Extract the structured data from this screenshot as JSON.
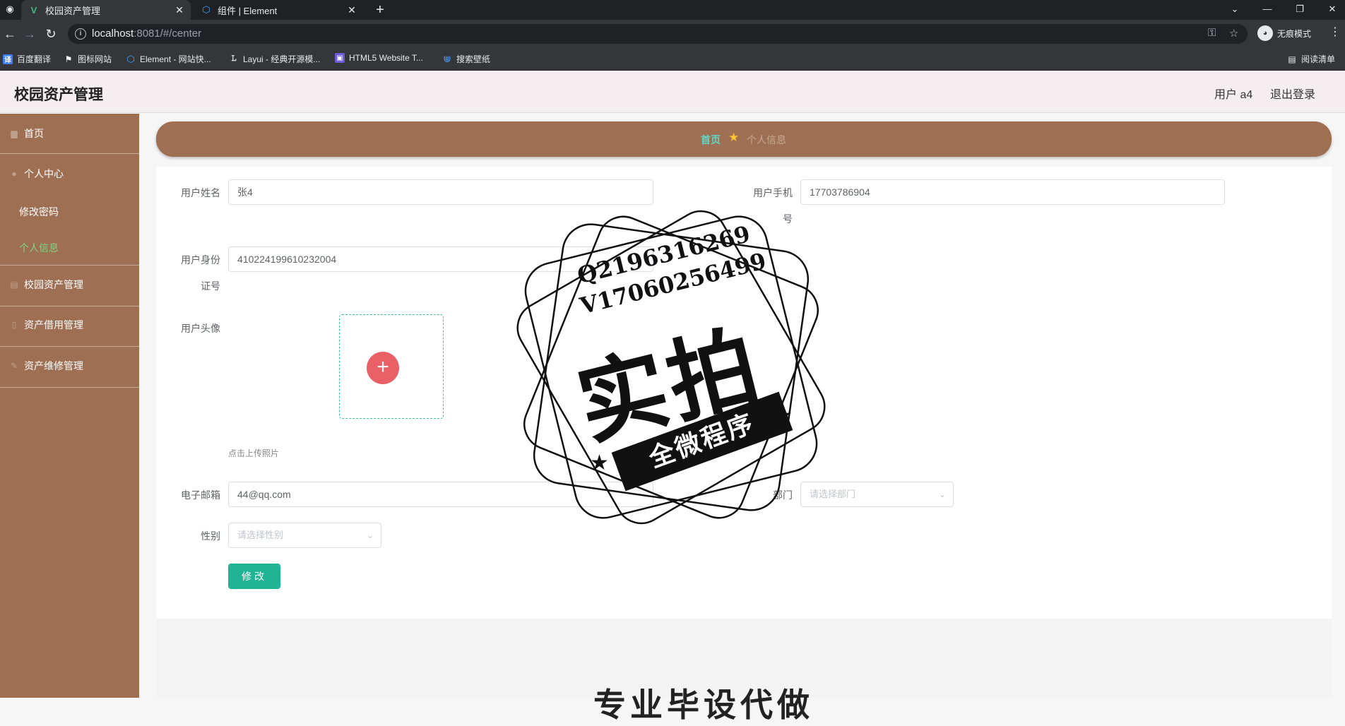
{
  "browser": {
    "tabs": [
      {
        "title": "校园资产管理",
        "active": true,
        "icon": "vue-icon"
      },
      {
        "title": "组件 | Element",
        "active": false,
        "icon": "element-icon"
      }
    ],
    "url_host": "localhost",
    "url_rest": ":8081/#/center",
    "incognito_label": "无痕模式",
    "bookmarks": [
      {
        "label": "百度翻译",
        "icon": "translate-icon",
        "color": "#3f7ef6"
      },
      {
        "label": "图标网站",
        "icon": "flag-icon",
        "color": "#ffffff"
      },
      {
        "label": "Element - 网站快...",
        "icon": "element-icon",
        "color": "#409eff"
      },
      {
        "label": "Layui - 经典开源模...",
        "icon": "layui-icon",
        "color": "#ffffff"
      },
      {
        "label": "HTML5 Website T...",
        "icon": "html5-icon",
        "color": "#6b5bd6"
      },
      {
        "label": "搜索壁纸",
        "icon": "wallpaper-icon",
        "color": "#4a90e2"
      }
    ],
    "reading_list_label": "阅读清单"
  },
  "header": {
    "title": "校园资产管理",
    "user_label": "用户 a4",
    "logout_label": "退出登录"
  },
  "sidebar": {
    "items": [
      {
        "label": "首页",
        "icon": "home-icon"
      },
      {
        "label": "个人中心",
        "icon": "user-icon",
        "children": [
          {
            "label": "修改密码",
            "active": false
          },
          {
            "label": "个人信息",
            "active": true
          }
        ]
      },
      {
        "label": "校园资产管理",
        "icon": "asset-icon"
      },
      {
        "label": "资产借用管理",
        "icon": "borrow-icon"
      },
      {
        "label": "资产维修管理",
        "icon": "repair-icon"
      }
    ]
  },
  "breadcrumb": {
    "home": "首页",
    "current": "个人信息"
  },
  "form": {
    "name_label": "用户姓名",
    "name_value": "张4",
    "phone_label_1": "用户手机",
    "phone_label_2": "号",
    "phone_value": "17703786904",
    "id_label_1": "用户身份",
    "id_label_2": "证号",
    "id_value": "410224199610232004",
    "avatar_label": "用户头像",
    "upload_hint": "点击上传照片",
    "email_label": "电子邮箱",
    "email_value": "44@qq.com",
    "dept_label": "部门",
    "dept_placeholder": "请选择部门",
    "gender_label": "性别",
    "gender_placeholder": "请选择性别",
    "submit_label": "修改"
  },
  "watermark": {
    "line1": "Q2196316269",
    "line2": "V17060256499",
    "big": "实拍",
    "ribbon": "全微程序"
  },
  "footer_text": "专业毕设代做"
}
